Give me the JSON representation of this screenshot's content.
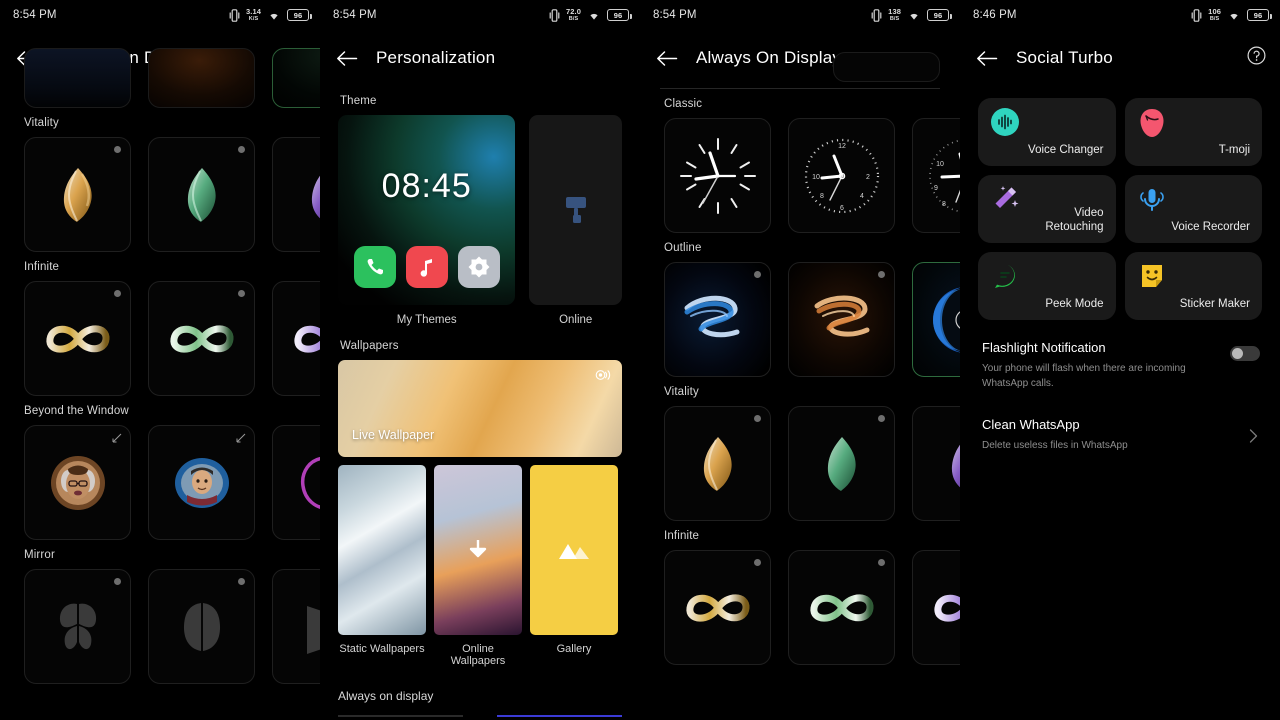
{
  "panels": [
    {
      "id": "aod-1",
      "statusbar": {
        "time": "8:54 PM",
        "net_speed": "3.14",
        "net_unit": "K/S",
        "battery": "96",
        "icons": [
          "vibrate-icon",
          "network-speed",
          "wifi-icon",
          "battery-icon"
        ]
      },
      "appbar": {
        "title": "Always On Display",
        "back_icon": "arrow-left-icon"
      },
      "sections": [
        {
          "label": "Vitality",
          "items": [
            {
              "name": "tulip-amber",
              "color": "#e2a33c",
              "mark": "dot"
            },
            {
              "name": "tulip-green",
              "color": "#6cc18f",
              "mark": "dot"
            },
            {
              "name": "tulip-violet",
              "color": "#9a6fd8",
              "mark": "dot"
            }
          ]
        },
        {
          "label": "Infinite",
          "items": [
            {
              "name": "infinity-gold",
              "color": "#d8b14a",
              "mark": "dot"
            },
            {
              "name": "infinity-green",
              "color": "#86c98a",
              "mark": "dot"
            },
            {
              "name": "infinity-violet",
              "color": "#b08ede",
              "mark": "dot"
            }
          ]
        },
        {
          "label": "Beyond the Window",
          "items": [
            {
              "name": "portrait-woman",
              "color": "#c68f63",
              "mark": "edit"
            },
            {
              "name": "portrait-man",
              "color": "#2f7fc4",
              "mark": "edit"
            },
            {
              "name": "portrait-outline",
              "color": "#b13fb8",
              "mark": "edit"
            }
          ]
        },
        {
          "label": "Mirror",
          "items": [
            {
              "name": "mirror-butterfly",
              "color": "#3b3b3b",
              "mark": "dot"
            },
            {
              "name": "mirror-wings",
              "color": "#3b3b3b",
              "mark": "dot"
            },
            {
              "name": "mirror-fold",
              "color": "#3b3b3b",
              "mark": "dot"
            }
          ]
        }
      ]
    },
    {
      "id": "personalization",
      "statusbar": {
        "time": "8:54 PM",
        "net_speed": "72.0",
        "net_unit": "B/S",
        "battery": "96",
        "icons": [
          "vibrate-icon",
          "network-speed",
          "wifi-icon",
          "battery-icon"
        ]
      },
      "appbar": {
        "title": "Personalization",
        "back_icon": "arrow-left-icon"
      },
      "theme": {
        "label": "Theme",
        "preview_clock": "08:45",
        "app_icons": [
          "phone-icon",
          "music-icon",
          "settings-icon"
        ],
        "my_themes_label": "My Themes",
        "online_label": "Online",
        "online_icon": "paint-roller-icon"
      },
      "wallpapers": {
        "label": "Wallpapers",
        "live_label": "Live Wallpaper",
        "live_badge_icon": "live-photo-icon",
        "tiles": [
          {
            "name": "static-wallpapers",
            "caption": "Static Wallpapers"
          },
          {
            "name": "online-wallpapers",
            "caption": "Online Wallpapers",
            "badge_icon": "download-icon"
          },
          {
            "name": "gallery",
            "caption": "Gallery",
            "badge_icon": "mountains-icon"
          }
        ]
      },
      "aod_row_label": "Always on display"
    },
    {
      "id": "aod-2",
      "statusbar": {
        "time": "8:54 PM",
        "net_speed": "138",
        "net_unit": "B/S",
        "battery": "96",
        "icons": [
          "vibrate-icon",
          "network-speed",
          "wifi-icon",
          "battery-icon"
        ]
      },
      "appbar": {
        "title": "Always On Display",
        "back_icon": "arrow-left-icon"
      },
      "sections": [
        {
          "label": "Classic",
          "items": [
            {
              "name": "clock-ticks",
              "mark": "none"
            },
            {
              "name": "clock-dots",
              "mark": "none"
            },
            {
              "name": "clock-numerals",
              "mark": "none"
            }
          ]
        },
        {
          "label": "Outline",
          "items": [
            {
              "name": "outline-blue-swirl",
              "color": "#2f8ae0",
              "mark": "dot"
            },
            {
              "name": "outline-amber-swirl",
              "color": "#d9803a",
              "mark": "dot"
            },
            {
              "name": "outline-planet",
              "color": "#1f6fd0",
              "mark": "dot",
              "selected": true
            }
          ]
        },
        {
          "label": "Vitality",
          "items": [
            {
              "name": "tulip-amber",
              "color": "#e2a33c",
              "mark": "dot"
            },
            {
              "name": "tulip-green",
              "color": "#6cc18f",
              "mark": "dot"
            },
            {
              "name": "tulip-violet",
              "color": "#9a6fd8",
              "mark": "dot"
            }
          ]
        },
        {
          "label": "Infinite",
          "items": [
            {
              "name": "infinity-gold",
              "color": "#d8b14a",
              "mark": "dot"
            },
            {
              "name": "infinity-green",
              "color": "#86c98a",
              "mark": "dot"
            },
            {
              "name": "infinity-violet",
              "color": "#b08ede",
              "mark": "dot"
            }
          ]
        }
      ]
    },
    {
      "id": "social-turbo",
      "statusbar": {
        "time": "8:46 PM",
        "net_speed": "106",
        "net_unit": "B/S",
        "battery": "96",
        "icons": [
          "vibrate-icon",
          "network-speed",
          "wifi-icon",
          "battery-icon"
        ]
      },
      "appbar": {
        "title": "Social Turbo",
        "back_icon": "arrow-left-icon",
        "help_icon": "help-circle-icon"
      },
      "features": [
        {
          "name": "voice-changer",
          "label": "Voice Changer",
          "icon": "waveform-icon",
          "color": "#2fd4bf"
        },
        {
          "name": "t-moji",
          "label": "T-moji",
          "icon": "tmoji-face-icon",
          "color": "#f4566f"
        },
        {
          "name": "video-retouching",
          "label": "Video\nRetouching",
          "icon": "magic-wand-icon",
          "color": "#a96ce0"
        },
        {
          "name": "voice-recorder",
          "label": "Voice Recorder",
          "icon": "microphone-icon",
          "color": "#3aa0f0"
        },
        {
          "name": "peek-mode",
          "label": "Peek Mode",
          "icon": "chat-bubble-icon",
          "color": "#24c04a"
        },
        {
          "name": "sticker-maker",
          "label": "Sticker Maker",
          "icon": "sticker-icon",
          "color": "#f5c326"
        }
      ],
      "settings": [
        {
          "name": "flashlight-notification",
          "title": "Flashlight Notification",
          "sub": "Your phone will flash when there are incoming WhatsApp calls.",
          "control": "toggle",
          "value": "off"
        },
        {
          "name": "clean-whatsapp",
          "title": "Clean WhatsApp",
          "sub": "Delete useless files in WhatsApp",
          "control": "chevron",
          "chevron_icon": "chevron-right-icon"
        }
      ]
    }
  ]
}
